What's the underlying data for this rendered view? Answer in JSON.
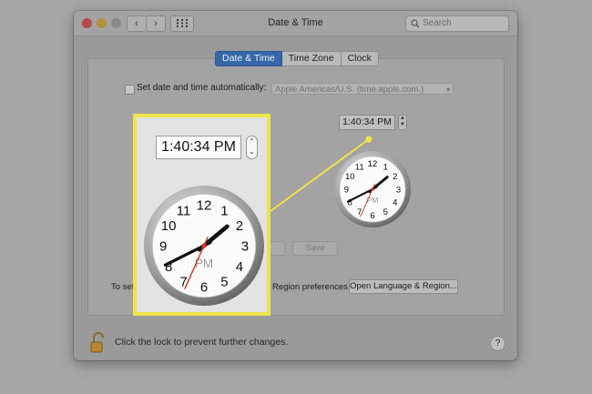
{
  "window": {
    "title": "Date & Time",
    "search_placeholder": "Search",
    "back_glyph": "‹",
    "forward_glyph": "›"
  },
  "tabs": [
    {
      "label": "Date & Time",
      "active": true
    },
    {
      "label": "Time Zone",
      "active": false
    },
    {
      "label": "Clock",
      "active": false
    }
  ],
  "auto_time": {
    "label": "Set date and time automatically:",
    "checked": false,
    "server": "Apple Americas/U.S. (time.apple.com.)"
  },
  "time": {
    "value": "1:40:34 PM",
    "period": "PM",
    "hour": 1,
    "minute": 40,
    "second": 34
  },
  "buttons": {
    "save": "Save",
    "open_language_region": "Open Language & Region..."
  },
  "region": {
    "prefix": "To set",
    "suffix": "Region preferences."
  },
  "footer": {
    "lock_text": "Click the lock to prevent further changes.",
    "help": "?"
  },
  "colors": {
    "highlight": "#f1e34a",
    "tab_active": "#3667a8",
    "second_hand": "#d23a2a"
  },
  "icons": {
    "lock": "lock-open-icon",
    "search": "search-icon",
    "grid": "grid-icon"
  }
}
